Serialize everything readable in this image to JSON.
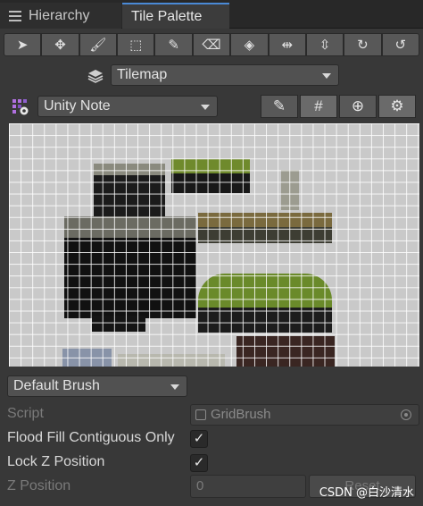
{
  "tabs": {
    "hierarchy": "Hierarchy",
    "tile_palette": "Tile Palette"
  },
  "toolbar": {
    "tools": [
      {
        "name": "select-tool",
        "glyph": "➤"
      },
      {
        "name": "move-tool",
        "glyph": "✥"
      },
      {
        "name": "paint-tool",
        "glyph": "🖌"
      },
      {
        "name": "box-fill-tool",
        "glyph": "⬚"
      },
      {
        "name": "picker-tool",
        "glyph": "✎"
      },
      {
        "name": "erase-tool",
        "glyph": "⌫"
      },
      {
        "name": "fill-tool",
        "glyph": "◈"
      },
      {
        "name": "flip-x-tool",
        "glyph": "⇹"
      },
      {
        "name": "flip-y-tool",
        "glyph": "⇳"
      },
      {
        "name": "rotate-cw-tool",
        "glyph": "↻"
      },
      {
        "name": "rotate-ccw-tool",
        "glyph": "↺"
      }
    ]
  },
  "tilemap": {
    "selected": "Tilemap"
  },
  "palette": {
    "selected": "Unity Note"
  },
  "palette_buttons": [
    {
      "name": "edit-icon",
      "glyph": "✎"
    },
    {
      "name": "grid-icon",
      "glyph": "#"
    },
    {
      "name": "gizmo-icon",
      "glyph": "⊕"
    },
    {
      "name": "settings-icon",
      "glyph": "⚙"
    }
  ],
  "brush": {
    "selected": "Default Brush"
  },
  "inspector": {
    "script_label": "Script",
    "script_value": "GridBrush",
    "flood_fill_label": "Flood Fill Contiguous Only",
    "flood_fill_checked": "✓",
    "lock_z_label": "Lock Z Position",
    "lock_z_checked": "✓",
    "z_position_label": "Z Position",
    "z_position_value": "0",
    "reset_label": "Reset"
  },
  "watermark": "CSDN @白沙清水"
}
